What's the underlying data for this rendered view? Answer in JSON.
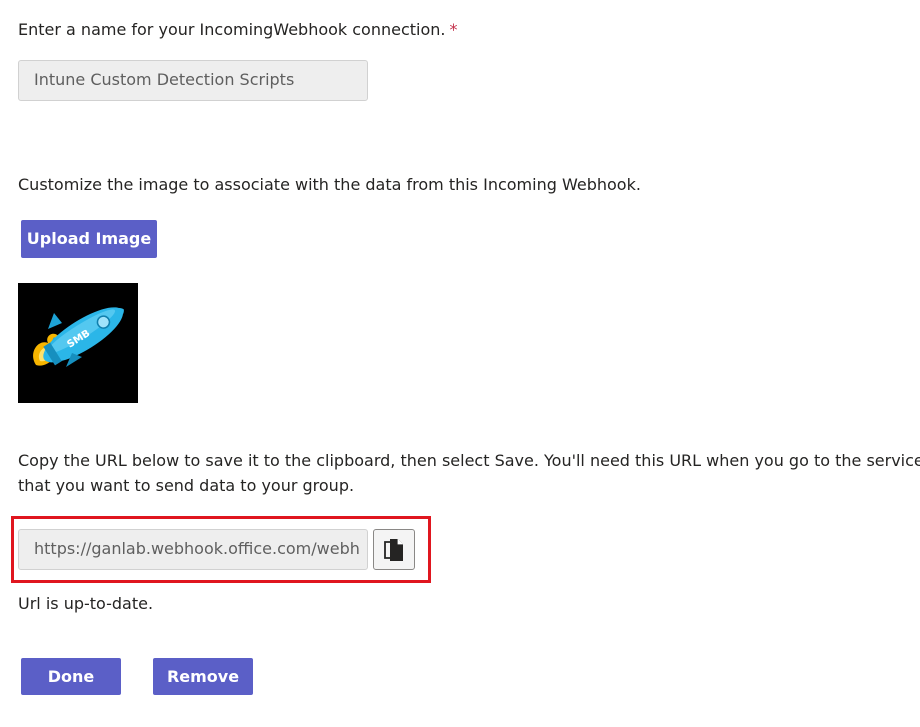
{
  "name_section": {
    "label": "Enter a name for your IncomingWebhook connection.",
    "required_marker": "*",
    "input_value": "Intune Custom Detection Scripts"
  },
  "image_section": {
    "label": "Customize the image to associate with the data from this Incoming Webhook.",
    "upload_button": "Upload Image",
    "image_badge_text": "SMB"
  },
  "url_section": {
    "instructions_line1": "Copy the URL below to save it to the clipboard, then select Save. You'll need this URL when you go to the service",
    "instructions_line2": "that you want to send data to your group.",
    "url_value": "https://ganlab.webhook.office.com/webh",
    "copy_icon": "copy-icon",
    "status": "Url is up-to-date."
  },
  "actions": {
    "done_button": "Done",
    "remove_button": "Remove"
  },
  "colors": {
    "accent": "#5b5fc7",
    "required": "#c4314b",
    "highlight_border": "#e0161f"
  }
}
